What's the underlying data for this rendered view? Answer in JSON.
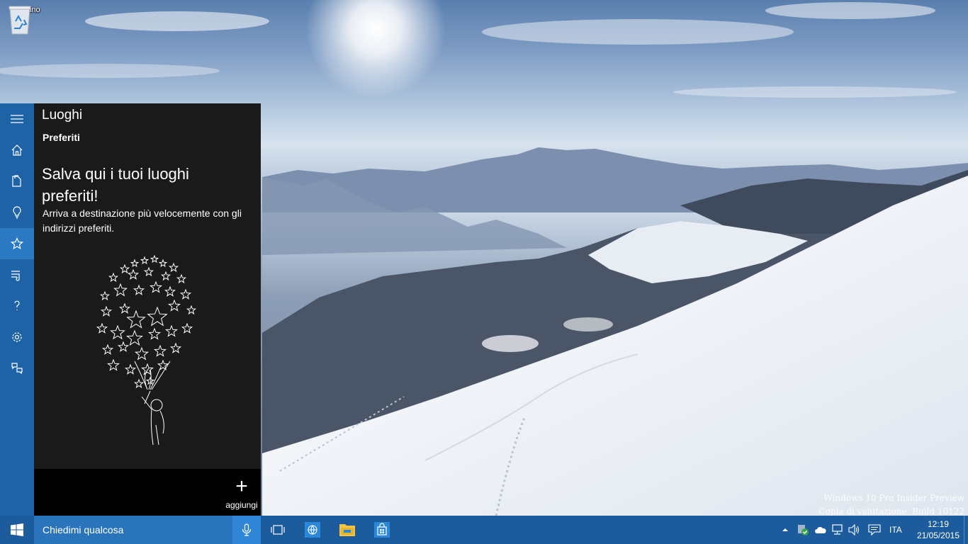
{
  "desktop": {
    "recycle_bin_label": "Cestino",
    "watermark_line1": "Windows 10 Pro Insider Preview",
    "watermark_line2": "Copia di valutazione. Build 10122"
  },
  "cortana": {
    "title": "Luoghi",
    "subtitle": "Preferiti",
    "heading": "Salva qui i tuoi luoghi preferiti!",
    "description": "Arriva a destinazione più velocemente con gli indirizzi preferiti.",
    "add_label": "aggiungi",
    "rail_items": [
      {
        "icon": "hamburger-menu-icon"
      },
      {
        "icon": "home-icon"
      },
      {
        "icon": "notebook-icon"
      },
      {
        "icon": "lightbulb-icon"
      },
      {
        "icon": "star-icon",
        "active": true
      },
      {
        "icon": "reminders-icon"
      },
      {
        "icon": "help-icon"
      },
      {
        "icon": "settings-icon"
      },
      {
        "icon": "feedback-icon"
      }
    ]
  },
  "taskbar": {
    "search_placeholder": "Chiedimi qualcosa",
    "language": "ITA",
    "time": "12:19",
    "date": "21/05/2015"
  },
  "colors": {
    "taskbar": "#1d5c9c",
    "rail": "#1d63a6",
    "panel": "#1a1a1a",
    "search_box": "#2a74bb"
  }
}
